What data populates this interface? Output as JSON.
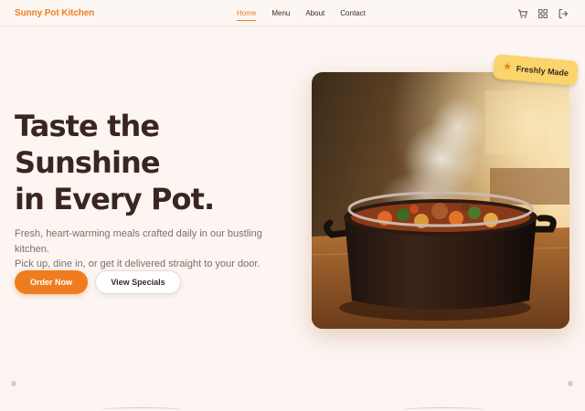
{
  "brand": {
    "name": "Sunny Pot Kitchen"
  },
  "nav": {
    "links": [
      {
        "label": "Home",
        "active": true
      },
      {
        "label": "Menu",
        "active": false
      },
      {
        "label": "About",
        "active": false
      },
      {
        "label": "Contact",
        "active": false
      }
    ],
    "icons": [
      "cart-icon",
      "grid-icon",
      "logout-icon"
    ]
  },
  "hero": {
    "title_lines": [
      "Taste the",
      "Sunshine",
      "in Every Pot."
    ],
    "description_lines": [
      "Fresh, heart-warming meals crafted daily in our bustling kitchen.",
      "Pick up, dine in, or get it delivered straight to your door."
    ],
    "primary_button": "Order Now",
    "secondary_button": "View Specials"
  },
  "badge": {
    "icon": "star-icon",
    "text": "Freshly Made"
  },
  "colors": {
    "accent": "#ef7d1f",
    "background": "#fcf5f1",
    "text_dark": "#3a2620",
    "text_muted": "#7c6f69",
    "badge": "#fbd46b"
  }
}
